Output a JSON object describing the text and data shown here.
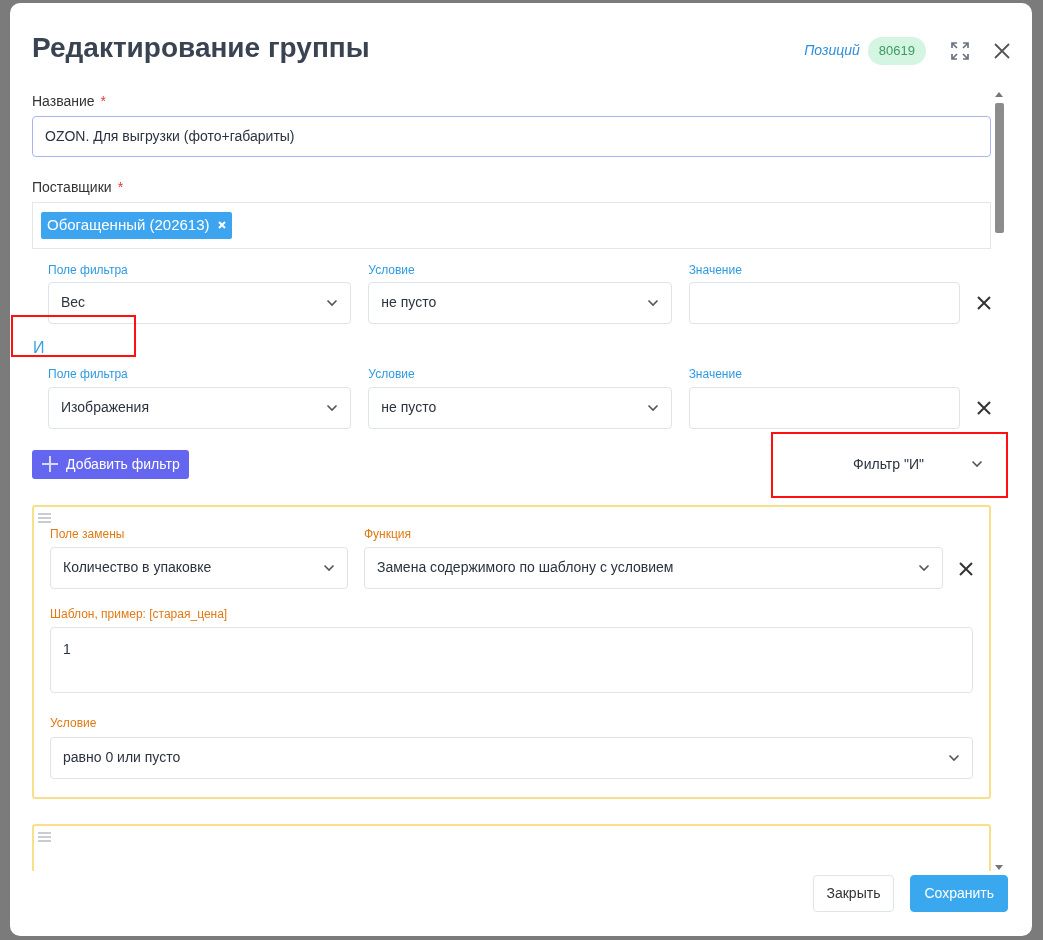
{
  "dialog": {
    "title": "Редактирование группы",
    "positions_label": "Позиций",
    "positions_count": "80619"
  },
  "name_field": {
    "label": "Название",
    "required_mark": "*",
    "value": "OZON. Для выгрузки (фото+габариты)"
  },
  "suppliers_field": {
    "label": "Поставщики",
    "required_mark": "*",
    "tags": [
      {
        "label": "Обогащенный (202613)"
      }
    ]
  },
  "filter_items": [
    {
      "kind": "filter",
      "field_label": "Поле фильтра",
      "field_value": "Вес",
      "condition_label": "Условие",
      "condition_value": "не пусто",
      "value_label": "Значение"
    },
    {
      "kind": "connector",
      "text": "И",
      "highlighted": true
    },
    {
      "kind": "filter",
      "field_label": "Поле фильтра",
      "field_value": "Изображения",
      "condition_label": "Условие",
      "condition_value": "не пусто",
      "value_label": "Значение"
    }
  ],
  "add_filter_button": "Добавить фильтр",
  "filter_mode": {
    "value": "Фильтр \"И\"",
    "highlighted": true
  },
  "replacements": [
    {
      "kind": "full",
      "field_label": "Поле замены",
      "field_value": "Количество в упаковке",
      "function_label": "Функция",
      "function_value": "Замена содержимого по шаблону с условием",
      "template_label": "Шаблон, пример: [старая_цена]",
      "template_value": "1",
      "condition_label": "Условие",
      "condition_value": "равно 0 или пусто"
    },
    {
      "kind": "clipped"
    }
  ],
  "buttons": [
    {
      "label": "Закрыть",
      "kind": "secondary"
    },
    {
      "label": "Сохранить",
      "kind": "primary"
    }
  ]
}
